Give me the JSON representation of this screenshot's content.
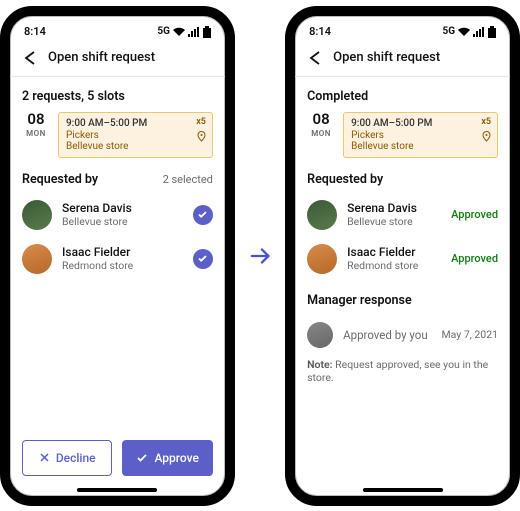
{
  "status_bar": {
    "time": "8:14",
    "network": "5G"
  },
  "header": {
    "title": "Open shift request"
  },
  "shift": {
    "day": "08",
    "weekday": "MON",
    "time": "9:00 AM–5:00 PM",
    "role": "Pickers",
    "store": "Bellevue store",
    "slots": "x5"
  },
  "left": {
    "summary": "2 requests, 5 slots",
    "selected_text": "2 selected",
    "req_label": "Requested by",
    "people": [
      {
        "name": "Serena Davis",
        "store": "Bellevue store"
      },
      {
        "name": "Isaac Fielder",
        "store": "Redmond store"
      }
    ],
    "decline": "Decline",
    "approve": "Approve"
  },
  "right": {
    "summary": "Completed",
    "req_label": "Requested by",
    "people": [
      {
        "name": "Serena Davis",
        "store": "Bellevue store",
        "status": "Approved"
      },
      {
        "name": "Isaac Fielder",
        "store": "Redmond store",
        "status": "Approved"
      }
    ],
    "mgr_label": "Manager response",
    "mgr_text": "Approved by you",
    "mgr_date": "May 7, 2021",
    "note_label": "Note:",
    "note_text": " Request approved, see you in the store."
  }
}
